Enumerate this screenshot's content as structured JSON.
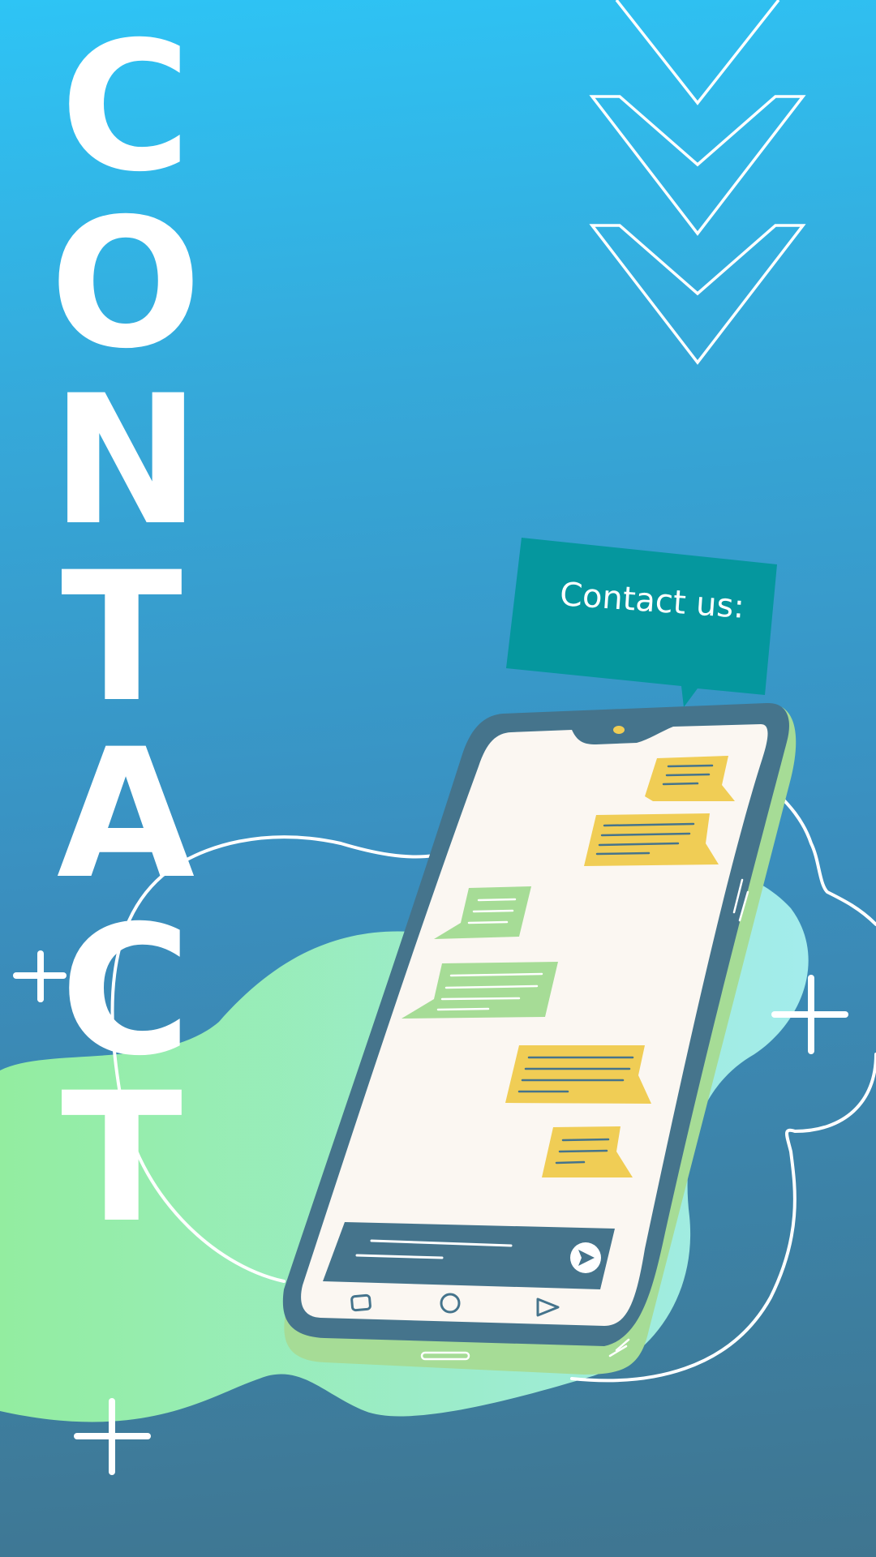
{
  "headline": {
    "word": "CONTACT",
    "letters": [
      "C",
      "O",
      "N",
      "T",
      "A",
      "C",
      "T"
    ]
  },
  "speech_bubble": {
    "label": "Contact us:"
  },
  "colors": {
    "background_top": "#2ec4f5",
    "background_bottom": "#3f7590",
    "blob_green": "#93eda0",
    "blob_aqua": "#a3ecec",
    "bubble_teal": "#05979e",
    "phone_frame": "#45748c",
    "phone_screen": "#fbf7f2",
    "message_yellow": "#f0cd55",
    "message_green": "#a6dc96"
  },
  "icons": [
    "chevron-down-icon",
    "plus-icon",
    "send-icon",
    "phone-camera-icon"
  ]
}
